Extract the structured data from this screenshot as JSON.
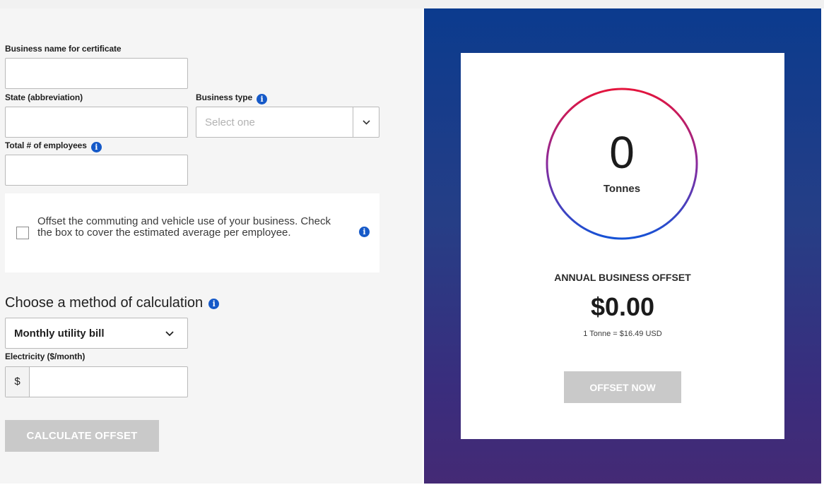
{
  "form": {
    "business_name_label": "Business name for certificate",
    "business_name_value": "",
    "state_label": "State (abbreviation)",
    "state_value": "",
    "business_type_label": "Business type",
    "business_type_placeholder": "Select one",
    "employees_label": "Total # of employees",
    "employees_value": "",
    "commute_offset_text": "Offset the commuting and vehicle use of your business. Check the box to cover the estimated average per employee.",
    "commute_offset_checked": false,
    "method_title": "Choose a method of calculation",
    "method_selected": "Monthly utility bill",
    "electricity_label": "Electricity ($/month)",
    "currency_symbol": "$",
    "electricity_value": "",
    "calculate_button": "CALCULATE OFFSET"
  },
  "summary": {
    "tonnes_value": "0",
    "tonnes_unit": "Tonnes",
    "heading": "ANNUAL BUSINESS OFFSET",
    "amount": "$0.00",
    "rate": "1 Tonne = $16.49 USD",
    "offset_button": "OFFSET NOW",
    "ring_color_top": "#e4143c",
    "ring_color_bottom": "#1552d6"
  },
  "icons": {
    "info": "info-icon",
    "dropdown": "chevron-down-icon",
    "checkbox": "checkbox-icon"
  },
  "colors": {
    "info_blue": "#1559c8",
    "panel_gradient_top": "#0b3b8e",
    "panel_gradient_bottom": "#442a75",
    "disabled_button": "#c9c9c9"
  }
}
